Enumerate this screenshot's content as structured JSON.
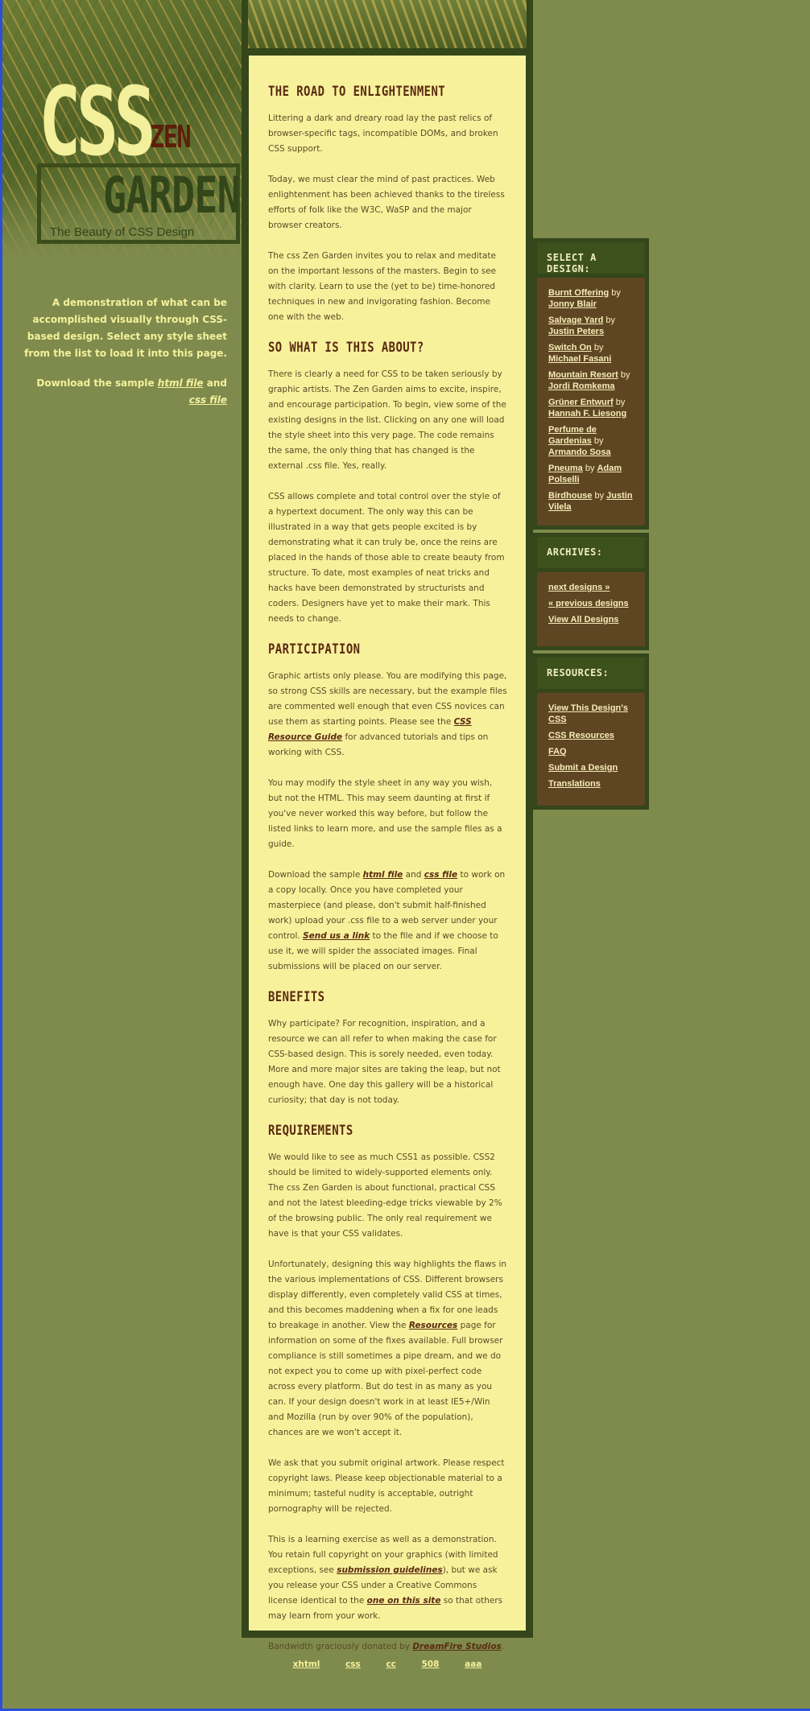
{
  "header": {
    "logo_css": "CSS",
    "logo_zen": "ZEN",
    "logo_garden": "GARDEN",
    "tagline": "The Beauty of CSS Design"
  },
  "intro": {
    "summary": "A demonstration of what can be accomplished visually through CSS-based design. Select any style sheet from the list to load it into this page.",
    "download_prefix": "Download the sample",
    "html_file": "html file",
    "and": "and",
    "css_file": "css file"
  },
  "sections": {
    "preamble": {
      "title": "THE ROAD TO ENLIGHTENMENT",
      "p1": "Littering a dark and dreary road lay the past relics of browser-specific tags, incompatible DOMs, and broken CSS support.",
      "p2": "Today, we must clear the mind of past practices. Web enlightenment has been achieved thanks to the tireless efforts of folk like the W3C, WaSP and the major browser creators.",
      "p3": "The css Zen Garden invites you to relax and meditate on the important lessons of the masters. Begin to see with clarity. Learn to use the (yet to be) time-honored techniques in new and invigorating fashion. Become one with the web."
    },
    "explanation": {
      "title": "SO WHAT IS THIS ABOUT?",
      "p1": "There is clearly a need for CSS to be taken seriously by graphic artists. The Zen Garden aims to excite, inspire, and encourage participation. To begin, view some of the existing designs in the list. Clicking on any one will load the style sheet into this very page. The code remains the same, the only thing that has changed is the external .css file. Yes, really.",
      "p2": "CSS allows complete and total control over the style of a hypertext document. The only way this can be illustrated in a way that gets people excited is by demonstrating what it can truly be, once the reins are placed in the hands of those able to create beauty from structure. To date, most examples of neat tricks and hacks have been demonstrated by structurists and coders. Designers have yet to make their mark. This needs to change."
    },
    "participation": {
      "title": "PARTICIPATION",
      "p1_a": "Graphic artists only please. You are modifying this page, so strong CSS skills are necessary, but the example files are commented well enough that even CSS novices can use them as starting points. Please see the",
      "p1_link": "CSS Resource Guide",
      "p1_b": "for advanced tutorials and tips on working with CSS.",
      "p2": "You may modify the style sheet in any way you wish, but not the HTML. This may seem daunting at first if you've never worked this way before, but follow the listed links to learn more, and use the sample files as a guide.",
      "p3_a": "Download the sample",
      "p3_html": "html file",
      "p3_and": "and",
      "p3_css": "css file",
      "p3_b": "to work on a copy locally. Once you have completed your masterpiece (and please, don't submit half-finished work) upload your .css file to a web server under your control.",
      "p3_link": "Send us a link",
      "p3_c": "to the file and if we choose to use it, we will spider the associated images. Final submissions will be placed on our server."
    },
    "benefits": {
      "title": "BENEFITS",
      "p1": "Why participate? For recognition, inspiration, and a resource we can all refer to when making the case for CSS-based design. This is sorely needed, even today. More and more major sites are taking the leap, but not enough have. One day this gallery will be a historical curiosity; that day is not today."
    },
    "requirements": {
      "title": "REQUIREMENTS",
      "p1": "We would like to see as much CSS1 as possible. CSS2 should be limited to widely-supported elements only. The css Zen Garden is about functional, practical CSS and not the latest bleeding-edge tricks viewable by 2% of the browsing public. The only real requirement we have is that your CSS validates.",
      "p2_a": "Unfortunately, designing this way highlights the flaws in the various implementations of CSS. Different browsers display differently, even completely valid CSS at times, and this becomes maddening when a fix for one leads to breakage in another. View the",
      "p2_link": "Resources",
      "p2_b": "page for information on some of the fixes available. Full browser compliance is still sometimes a pipe dream, and we do not expect you to come up with pixel-perfect code across every platform. But do test in as many as you can. If your design doesn't work in at least IE5+/Win and Mozilla (run by over 90% of the population), chances are we won't accept it.",
      "p3": "We ask that you submit original artwork. Please respect copyright laws. Please keep objectionable material to a minimum; tasteful nudity is acceptable, outright pornography will be rejected.",
      "p4_a": "This is a learning exercise as well as a demonstration. You retain full copyright on your graphics (with limited exceptions, see",
      "p4_link1": "submission guidelines",
      "p4_b": "), but we ask you release your CSS under a Creative Commons license identical to the",
      "p4_link2": "one on this site",
      "p4_c": "so that others may learn from your work.",
      "p5_a": "Bandwidth graciously donated by",
      "p5_link": "DreamFire Studios",
      "p5_b": "."
    }
  },
  "sidebar": {
    "design_title": "SELECT A DESIGN:",
    "designs": [
      {
        "name": "Burnt Offering",
        "by": "by",
        "author": "Jonny Blair"
      },
      {
        "name": "Salvage Yard",
        "by": "by",
        "author": "Justin Peters"
      },
      {
        "name": "Switch On",
        "by": "by",
        "author": "Michael Fasani"
      },
      {
        "name": "Mountain Resort",
        "by": "by",
        "author": "Jordi Romkema"
      },
      {
        "name": "Grüner Entwurf",
        "by": "by",
        "author": "Hannah F. Liesong"
      },
      {
        "name": "Perfume de Gardenias",
        "by": "by",
        "author": "Armando Sosa"
      },
      {
        "name": "Pneuma",
        "by": "by",
        "author": "Adam Polselli"
      },
      {
        "name": "Birdhouse",
        "by": "by",
        "author": "Justin Vilela"
      }
    ],
    "archives_title": "ARCHIVES:",
    "archives": {
      "next": "next designs »",
      "prev": "« previous designs",
      "all": "View All Designs"
    },
    "resources_title": "RESOURCES:",
    "resources": {
      "view_css": "View This Design's CSS",
      "css_resources": "CSS Resources",
      "faq": "FAQ",
      "submit": "Submit a Design",
      "translations": "Translations"
    }
  },
  "footer": {
    "links": [
      "xhtml",
      "css",
      "cc",
      "508",
      "aaa"
    ]
  },
  "colors": {
    "background": "#7f8b4d",
    "main_panel": "#f8f19c",
    "heading": "#5a2a10",
    "sidebar_panel": "#5e4623",
    "frame": "#34461a",
    "light_text": "#f5f19b"
  }
}
